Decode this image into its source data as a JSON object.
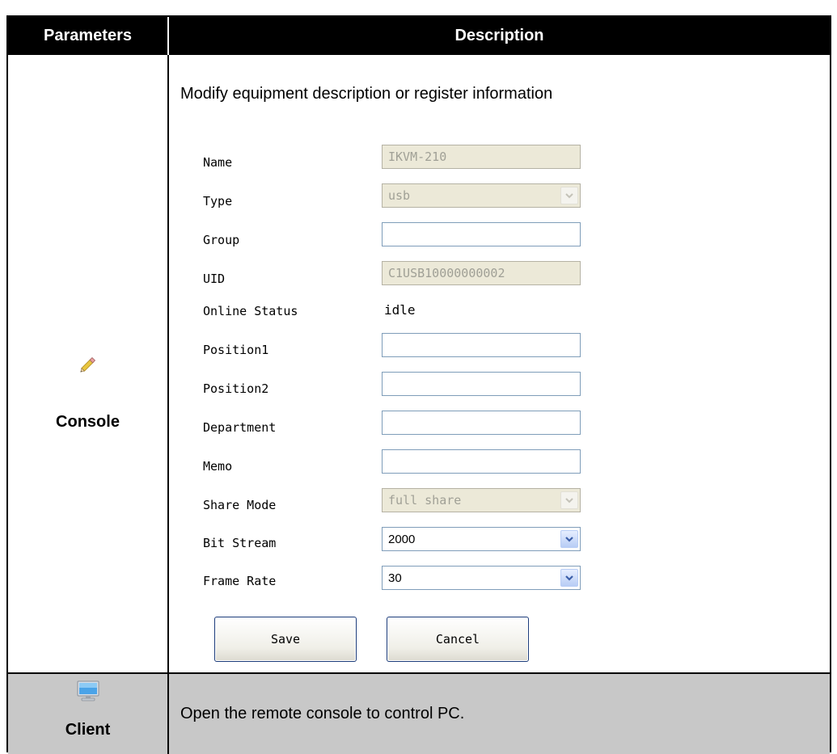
{
  "header": {
    "parameters": "Parameters",
    "description": "Description"
  },
  "console_row": {
    "label": "Console",
    "icon": "pencil-icon",
    "intro": "Modify equipment description or register information",
    "form": {
      "name": {
        "label": "Name",
        "value": "IKVM-210"
      },
      "type": {
        "label": "Type",
        "value": "usb"
      },
      "group": {
        "label": "Group",
        "value": ""
      },
      "uid": {
        "label": "UID",
        "value": "C1USB10000000002"
      },
      "online_status": {
        "label": "Online Status",
        "value": "idle"
      },
      "position1": {
        "label": "Position1",
        "value": ""
      },
      "position2": {
        "label": "Position2",
        "value": ""
      },
      "department": {
        "label": "Department",
        "value": ""
      },
      "memo": {
        "label": "Memo",
        "value": ""
      },
      "share_mode": {
        "label": "Share Mode",
        "value": "full share"
      },
      "bit_stream": {
        "label": "Bit Stream",
        "value": "2000"
      },
      "frame_rate": {
        "label": "Frame Rate",
        "value": "30"
      },
      "save_label": "Save",
      "cancel_label": "Cancel"
    }
  },
  "client_row": {
    "label": "Client",
    "icon": "monitor-icon",
    "description": "Open the remote console to control PC."
  },
  "colors": {
    "header_bg": "#000000",
    "client_row_bg": "#c8c8c8",
    "disabled_field_bg": "#ece9d8",
    "button_border": "#1c3c7a"
  }
}
